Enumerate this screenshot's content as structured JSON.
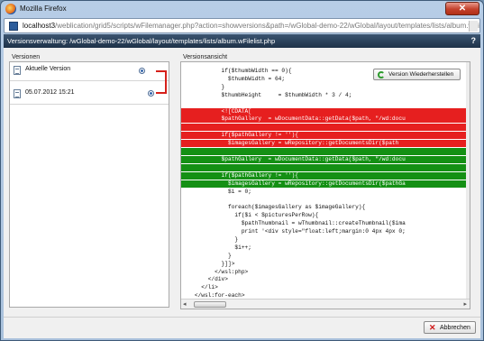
{
  "window": {
    "title": "Mozilla Firefox",
    "close_label": "✕"
  },
  "urlbar": {
    "host": "localhost3",
    "path": "/weblication/grid5/scripts/wFilemanager.php?action=showversions&path=/wGlobal-demo-22/wGlobal/layout/templates/lists/album.wFi"
  },
  "dialog": {
    "title": "Versionsverwaltung: /wGlobal-demo-22/wGlobal/layout/templates/lists/album.wFilelist.php",
    "help_label": "?",
    "versions_label": "Versionen",
    "view_label": "Versionsansicht",
    "restore_label": "Version Wiederherstellen",
    "cancel_label": "Abbrechen",
    "versions": [
      {
        "label": "Aktuelle Version"
      },
      {
        "label": "05.07.2012 15:21"
      }
    ],
    "accent_color": "#d6201a",
    "diff_colors": {
      "removed": "#e61f1f",
      "added": "#149014"
    }
  },
  "code": {
    "lines": [
      {
        "text": "            if($thumbWidth == 0){",
        "kind": "ctx"
      },
      {
        "text": "              $thumbWidth = 64;",
        "kind": "ctx"
      },
      {
        "text": "            }",
        "kind": "ctx"
      },
      {
        "text": "            $thumbHeight     = $thumbWidth * 3 / 4;",
        "kind": "ctx"
      },
      {
        "text": "",
        "kind": "ctx"
      },
      {
        "text": "            <![CDATA[",
        "kind": "del"
      },
      {
        "text": "            $pathGallery  = wDocumentData::getData($path, \"/wd:docu",
        "kind": "del"
      },
      {
        "text": "",
        "kind": "del"
      },
      {
        "text": "            if($pathGallery != ''){",
        "kind": "del"
      },
      {
        "text": "              $imagesGallery = wRepository::getDocumentsDir($path",
        "kind": "del"
      },
      {
        "text": "",
        "kind": "add"
      },
      {
        "text": "            $pathGallery  = wDocumentData::getData($path, \"/wd:docu",
        "kind": "add"
      },
      {
        "text": "",
        "kind": "add"
      },
      {
        "text": "            if($pathGallery != ''){",
        "kind": "add"
      },
      {
        "text": "              $imagesGallery = wRepository::getDocumentsDir($pathGa",
        "kind": "add"
      },
      {
        "text": "              $i = 0;",
        "kind": "ctx"
      },
      {
        "text": "",
        "kind": "ctx"
      },
      {
        "text": "              foreach($imagesGallery as $imageGallery){",
        "kind": "ctx"
      },
      {
        "text": "                if($i < $picturesPerRow){",
        "kind": "ctx"
      },
      {
        "text": "                  $pathThumbnail = wThumbnail::createThumbnail($ima",
        "kind": "ctx"
      },
      {
        "text": "                  print '<div style=\"float:left;margin:0 4px 4px 0;",
        "kind": "ctx"
      },
      {
        "text": "                }",
        "kind": "ctx"
      },
      {
        "text": "                $i++;",
        "kind": "ctx"
      },
      {
        "text": "              }",
        "kind": "ctx"
      },
      {
        "text": "            }]]>",
        "kind": "ctx"
      },
      {
        "text": "          </wsl:php>",
        "kind": "ctx"
      },
      {
        "text": "        </div>",
        "kind": "ctx"
      },
      {
        "text": "      </li>",
        "kind": "ctx"
      },
      {
        "text": "    </wsl:for-each>",
        "kind": "ctx"
      }
    ]
  }
}
